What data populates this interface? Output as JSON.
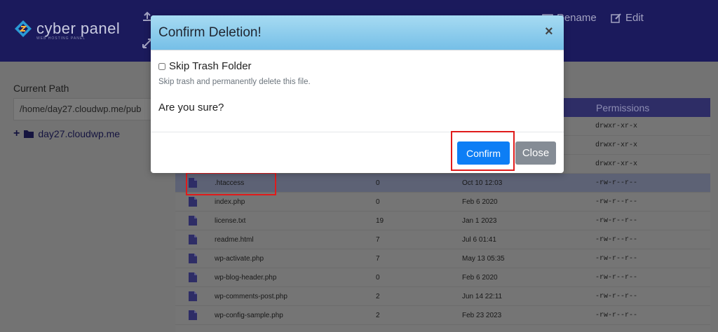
{
  "header": {
    "logo_text": "cyber panel",
    "logo_subtext": "WEB HOSTING PANEL",
    "tools": [
      {
        "label": "Rename",
        "icon": "rename-icon"
      },
      {
        "label": "Edit",
        "icon": "edit-icon"
      }
    ]
  },
  "sidebar": {
    "current_path_label": "Current Path",
    "current_path_value": "/home/day27.cloudwp.me/pub",
    "tree_root": "day27.cloudwp.me"
  },
  "file_table": {
    "permissions_header": "Permissions",
    "upper_permissions": [
      "drwxr-xr-x",
      "drwxr-xr-x",
      "drwxr-xr-x"
    ],
    "rows": [
      {
        "name": ".htaccess",
        "size": "0",
        "date": "Oct 10 12:03",
        "perms": "-rw-r--r--",
        "selected": true
      },
      {
        "name": "index.php",
        "size": "0",
        "date": "Feb 6 2020",
        "perms": "-rw-r--r--"
      },
      {
        "name": "license.txt",
        "size": "19",
        "date": "Jan 1 2023",
        "perms": "-rw-r--r--"
      },
      {
        "name": "readme.html",
        "size": "7",
        "date": "Jul 6 01:41",
        "perms": "-rw-r--r--"
      },
      {
        "name": "wp-activate.php",
        "size": "7",
        "date": "May 13 05:35",
        "perms": "-rw-r--r--"
      },
      {
        "name": "wp-blog-header.php",
        "size": "0",
        "date": "Feb 6 2020",
        "perms": "-rw-r--r--"
      },
      {
        "name": "wp-comments-post.php",
        "size": "2",
        "date": "Jun 14 22:11",
        "perms": "-rw-r--r--"
      },
      {
        "name": "wp-config-sample.php",
        "size": "2",
        "date": "Feb 23 2023",
        "perms": "-rw-r--r--"
      }
    ]
  },
  "modal": {
    "title": "Confirm Deletion!",
    "close_symbol": "×",
    "skip_trash_label": "Skip Trash Folder",
    "skip_trash_help": "Skip trash and permanently delete this file.",
    "question": "Are you sure?",
    "confirm_label": "Confirm",
    "close_label": "Close"
  },
  "colors": {
    "header_bg": "#1b1a5c",
    "modal_header_top": "#a7dbf2",
    "confirm_bg": "#0d7ef5",
    "close_bg": "#858c95",
    "highlight": "#e01b1b"
  }
}
